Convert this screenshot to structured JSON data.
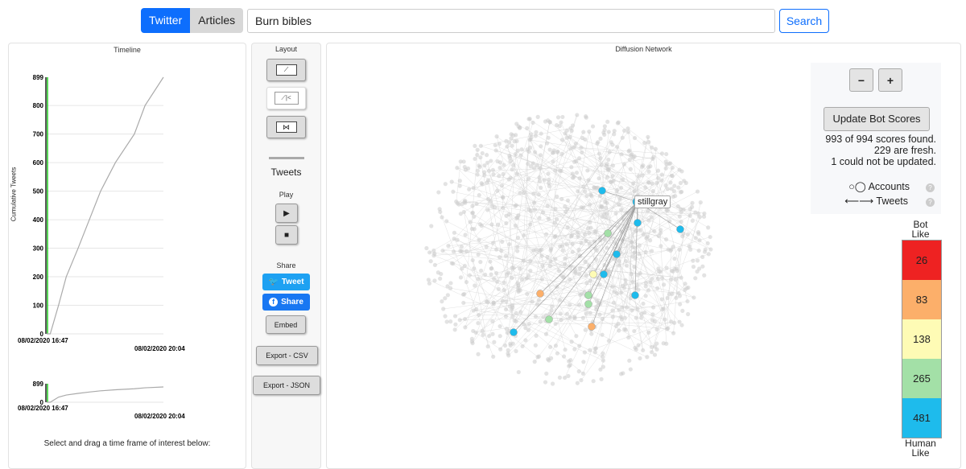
{
  "header": {
    "tabs": [
      {
        "label": "Twitter",
        "active": true
      },
      {
        "label": "Articles",
        "active": false
      }
    ],
    "search_value": "Burn bibles",
    "search_button": "Search"
  },
  "timeline": {
    "title": "Timeline",
    "ylabel": "Cumulative Tweets",
    "x_start": "08/02/2020 16:47",
    "x_end": "08/02/2020 20:04",
    "hint": "Select and drag a time frame of interest below:",
    "mini_ymax": "899",
    "mini_ymin": "0"
  },
  "chart_data": {
    "type": "line",
    "ylabel": "Cumulative Tweets",
    "yticks": [
      "0",
      "100",
      "200",
      "300",
      "400",
      "500",
      "600",
      "700",
      "800",
      "899"
    ],
    "ylim": [
      0,
      899
    ],
    "xlim": [
      "16:47",
      "20:04"
    ],
    "x_ticks": [
      "08/02/2020 16:47",
      "08/02/2020 20:04"
    ],
    "grid": true,
    "points": [
      [
        "16:47",
        0
      ],
      [
        "16:53",
        0
      ],
      [
        "17:07",
        100
      ],
      [
        "17:20",
        200
      ],
      [
        "17:40",
        300
      ],
      [
        "17:59",
        400
      ],
      [
        "18:18",
        500
      ],
      [
        "18:43",
        600
      ],
      [
        "19:15",
        700
      ],
      [
        "19:33",
        800
      ],
      [
        "20:04",
        899
      ]
    ]
  },
  "controls": {
    "layout_label": "Layout",
    "tweets_label": "Tweets",
    "play_label": "Play",
    "share_label": "Share",
    "tweet_btn": "Tweet",
    "share_btn": "Share",
    "embed": "Embed",
    "export_csv": "Export - CSV",
    "export_json": "Export - JSON"
  },
  "network": {
    "title": "Diffusion Network",
    "zoom_out": "−",
    "zoom_in": "+",
    "update_btn": "Update Bot Scores",
    "status": [
      "993 of 994 scores found.",
      "229 are fresh.",
      "1 could not be updated."
    ],
    "legend_accounts": "Accounts",
    "legend_tweets": "Tweets",
    "node_label": "stillgray"
  },
  "botscale": {
    "top": "Bot\nLike",
    "bottom": "Human\nLike",
    "bins": [
      {
        "value": "26",
        "color": "#ee2222"
      },
      {
        "value": "83",
        "color": "#fcaf6a"
      },
      {
        "value": "138",
        "color": "#fefbb5"
      },
      {
        "value": "265",
        "color": "#a3e0a7"
      },
      {
        "value": "481",
        "color": "#1ebbec"
      }
    ]
  }
}
